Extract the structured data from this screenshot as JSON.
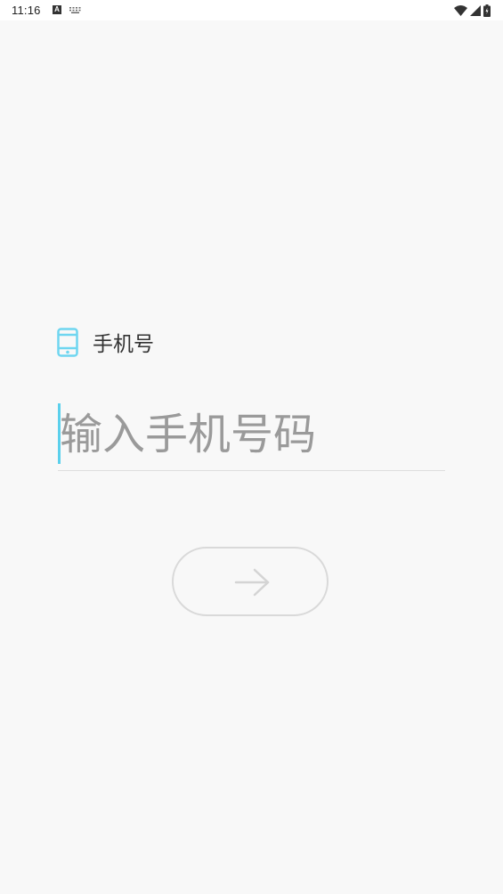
{
  "status_bar": {
    "time": "11:16",
    "notification_icon_letter": "A",
    "icons": [
      "a-notification-icon",
      "keyboard-icon",
      "wifi-icon",
      "signal-icon",
      "battery-icon"
    ]
  },
  "login_form": {
    "label": "手机号",
    "label_icon": "phone-icon",
    "input_placeholder": "输入手机号码",
    "input_value": "",
    "submit_icon": "arrow-right-icon"
  },
  "colors": {
    "background": "#f8f8f8",
    "accent": "#5bd0ec",
    "placeholder": "#9a9a9a",
    "button_border": "#d9d9d9"
  }
}
